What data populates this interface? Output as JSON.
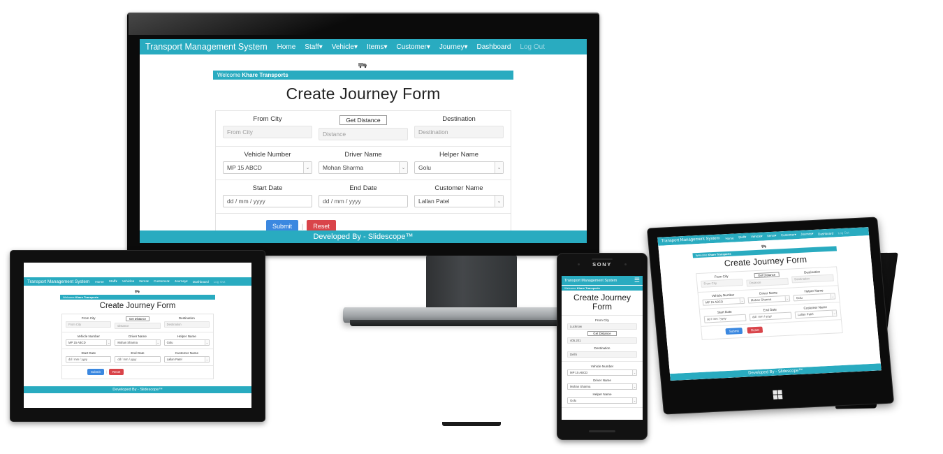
{
  "app": {
    "brand": "Transport Management System",
    "nav": [
      {
        "label": "Home",
        "caret": false,
        "muted": false
      },
      {
        "label": "Staff",
        "caret": true,
        "muted": false
      },
      {
        "label": "Vehicle",
        "caret": true,
        "muted": false
      },
      {
        "label": "Items",
        "caret": true,
        "muted": false
      },
      {
        "label": "Customer",
        "caret": true,
        "muted": false
      },
      {
        "label": "Journey",
        "caret": true,
        "muted": false
      },
      {
        "label": "Dashboard",
        "caret": false,
        "muted": false
      },
      {
        "label": "Log Out",
        "caret": false,
        "muted": true
      }
    ],
    "hamburger": "☰",
    "welcome_prefix": "Welcome ",
    "welcome_company": "Khare Transports",
    "page_title": "Create Journey Form",
    "footer": "Developed By - Slidescope™",
    "accent_color": "#29abc0",
    "submit_color": "#3b88e0",
    "reset_color": "#d9444a"
  },
  "form": {
    "labels": {
      "from_city": "From City",
      "destination": "Destination",
      "vehicle_number": "Vehicle Number",
      "driver_name": "Driver Name",
      "helper_name": "Helper Name",
      "start_date": "Start Date",
      "end_date": "End Date",
      "customer_name": "Customer Name"
    },
    "get_distance_label": "Get Distance",
    "placeholders": {
      "from_city": "From City",
      "distance": "Distance",
      "destination": "Destination",
      "date": "dd / mm / yyyy"
    },
    "values": {
      "vehicle_number": "MP 15 ABCD",
      "driver_name": "Mohan Sharma",
      "helper_name": "Golu",
      "customer_name": "Lallan Patel"
    },
    "buttons": {
      "submit": "Submit",
      "reset": "Reset",
      "separator": "|"
    },
    "select_caret": "⌄"
  },
  "mobile_values": {
    "from_city": "Lucknow",
    "distance": "405.201",
    "destination": "Delhi",
    "vehicle_number": "MP 15 ABCD",
    "driver_name": "Mohan Sharma",
    "helper_name": "Golu"
  },
  "devices": {
    "phone_brand": "SONY"
  }
}
